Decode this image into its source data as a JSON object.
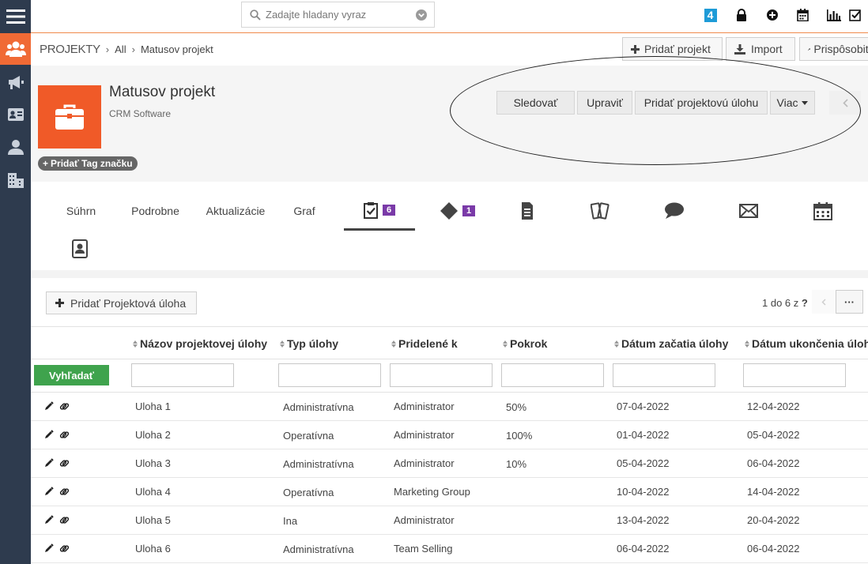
{
  "topbar": {
    "search_placeholder": "Zadajte hladany vyraz",
    "badge_number": "4"
  },
  "breadcrumb": {
    "root": "Projekty",
    "level1": "All",
    "current": "Matusov projekt"
  },
  "toolbar": {
    "add_project": "Pridať projekt",
    "import": "Import",
    "customize": "Prispôsobiť"
  },
  "record": {
    "title": "Matusov projekt",
    "subtitle": "CRM Software",
    "tag_button": "Pridať Tag značku"
  },
  "actions": {
    "follow": "Sledovať",
    "edit": "Upraviť",
    "add_task": "Pridať projektovú úlohu",
    "more": "Viac"
  },
  "tabs": {
    "summary": "Súhrn",
    "details": "Podrobne",
    "updates": "Aktualizácie",
    "chart": "Graf",
    "tasks_count": "6",
    "milestones_count": "1"
  },
  "panel": {
    "add_button": "Pridať Projektová úloha",
    "pager_text": "1 do 6  z",
    "pager_unknown": "?",
    "more": "···",
    "search_button": "Vyhľadať"
  },
  "table": {
    "columns": {
      "name": "Názov projektovej úlohy",
      "type": "Typ úlohy",
      "assigned": "Pridelené k",
      "progress": "Pokrok",
      "start": "Dátum začatia úlohy",
      "end": "Dátum ukončenia úlohy"
    },
    "rows": [
      {
        "name": "Uloha 1",
        "type": "Administratívna",
        "assigned": "Administrator",
        "progress": "50%",
        "start": "07-04-2022",
        "end": "12-04-2022"
      },
      {
        "name": "Uloha 2",
        "type": "Operatívna",
        "assigned": "Administrator",
        "progress": "100%",
        "start": "01-04-2022",
        "end": "05-04-2022"
      },
      {
        "name": "Uloha 3",
        "type": "Administratívna",
        "assigned": "Administrator",
        "progress": "10%",
        "start": "05-04-2022",
        "end": "06-04-2022"
      },
      {
        "name": "Uloha 4",
        "type": "Operatívna",
        "assigned": "Marketing Group",
        "progress": "",
        "start": "10-04-2022",
        "end": "14-04-2022"
      },
      {
        "name": "Uloha 5",
        "type": "Ina",
        "assigned": "Administrator",
        "progress": "",
        "start": "13-04-2022",
        "end": "20-04-2022"
      },
      {
        "name": "Uloha 6",
        "type": "Administratívna",
        "assigned": "Team Selling",
        "progress": "",
        "start": "06-04-2022",
        "end": "06-04-2022"
      }
    ]
  },
  "colors": {
    "sidebar": "#2e3b4e",
    "accent": "#f06a35",
    "count_badge": "#7a3aa8",
    "search_button": "#3fa34d"
  }
}
